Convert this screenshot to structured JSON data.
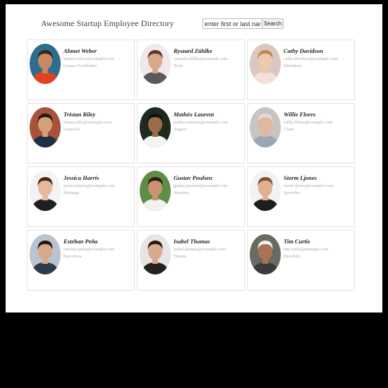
{
  "header": {
    "title": "Awesome Startup Employee Directory",
    "search_placeholder": "enter first or last name",
    "search_button": "Search"
  },
  "employees": [
    {
      "name": "Ahmet Weber",
      "email": "ahmet.weber@example.com",
      "city": "Guenn-Overflakke",
      "photo": {
        "bg": "#2d6e8e",
        "skin": "#c98a63",
        "hair": "#3a2415",
        "shirt": "#e0431e"
      }
    },
    {
      "name": "Ryszard Zühlke",
      "email": "ryszard.zühlke@example.com",
      "city": "Nails",
      "photo": {
        "bg": "#f0e8ea",
        "skin": "#d9a887",
        "hair": "#5a3a22",
        "shirt": "#5a5a5a"
      }
    },
    {
      "name": "Cathy Davidson",
      "email": "cathy.davidson@example.com",
      "city": "Sdenderry",
      "photo": {
        "bg": "#dcc6c0",
        "skin": "#edc9ad",
        "hair": "#b98a52",
        "shirt": "#f2e1d8"
      }
    },
    {
      "name": "Tristan Riley",
      "email": "tristan.riley@example.com",
      "city": "Limerick",
      "photo": {
        "bg": "#a8523a",
        "skin": "#d3a078",
        "hair": "#2a1a10",
        "shirt": "#1f2f45"
      }
    },
    {
      "name": "Mathéo Laurent",
      "email": "matheo.laurent@example.com",
      "city": "Angers",
      "photo": {
        "bg": "#1d2a1d",
        "skin": "#9a6c48",
        "hair": "#111",
        "shirt": "#f4f4f2"
      }
    },
    {
      "name": "Willie Flores",
      "email": "willie.flores@example.com",
      "city": "Clane",
      "photo": {
        "bg": "#c9c4c0",
        "skin": "#e0b8a0",
        "hair": "#ddd",
        "shirt": "#9aa7b2"
      }
    },
    {
      "name": "Jessica Harris",
      "email": "jessica.harris@example.com",
      "city": "Hastings",
      "photo": {
        "bg": "#f3f3f3",
        "skin": "#e7b99c",
        "hair": "#4a2716",
        "shirt": "#1f1f1f"
      }
    },
    {
      "name": "Gustav Poulsen",
      "email": "gustav.poulsen@example.com",
      "city": "Nærebro",
      "photo": {
        "bg": "#5f8d48",
        "skin": "#c99372",
        "hair": "#2b1d12",
        "shirt": "#f1f1f1"
      }
    },
    {
      "name": "Storm Ljones",
      "email": "storm.ljones@example.com",
      "city": "Sporvika",
      "photo": {
        "bg": "#f2f2f2",
        "skin": "#e0b093",
        "hair": "#7a5536",
        "shirt": "#1e1e1e"
      }
    },
    {
      "name": "Esteban Peña",
      "email": "esteban.peña@example.com",
      "city": "Barcelona",
      "photo": {
        "bg": "#b9c4cf",
        "skin": "#d7a889",
        "hair": "#221710",
        "shirt": "#2c3c4a"
      }
    },
    {
      "name": "Isabel Thomas",
      "email": "isabel.thomas@example.com",
      "city": "Timaru",
      "photo": {
        "bg": "#e8e4e2",
        "skin": "#d9a98c",
        "hair": "#2a1a12",
        "shirt": "#222"
      }
    },
    {
      "name": "Tim Curtis",
      "email": "tim.curtis@example.com",
      "city": "Honolulu",
      "photo": {
        "bg": "#6a6a62",
        "skin": "#a87452",
        "hair": "#f2f2f2",
        "shirt": "#3b3b3b"
      }
    }
  ]
}
